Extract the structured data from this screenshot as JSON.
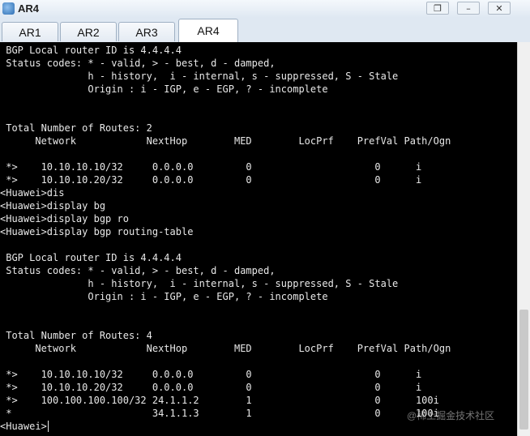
{
  "window": {
    "title": "AR4",
    "app_icon": "router-icon",
    "controls": {
      "restore": "❐",
      "minimize": "–",
      "close": "✕"
    }
  },
  "tabs": [
    {
      "label": "AR1",
      "active": false
    },
    {
      "label": "AR2",
      "active": false
    },
    {
      "label": "AR3",
      "active": false
    },
    {
      "label": "AR4",
      "active": true
    }
  ],
  "terminal": {
    "lines": [
      " BGP Local router ID is 4.4.4.4",
      " Status codes: * - valid, > - best, d - damped,",
      "               h - history,  i - internal, s - suppressed, S - Stale",
      "               Origin : i - IGP, e - EGP, ? - incomplete",
      "",
      "",
      " Total Number of Routes: 2",
      "      Network            NextHop        MED        LocPrf    PrefVal Path/Ogn",
      "",
      " *>    10.10.10.10/32     0.0.0.0         0                     0      i",
      " *>    10.10.10.20/32     0.0.0.0         0                     0      i",
      "<Huawei>dis",
      "<Huawei>display bg",
      "<Huawei>display bgp ro",
      "<Huawei>display bgp routing-table",
      "",
      " BGP Local router ID is 4.4.4.4",
      " Status codes: * - valid, > - best, d - damped,",
      "               h - history,  i - internal, s - suppressed, S - Stale",
      "               Origin : i - IGP, e - EGP, ? - incomplete",
      "",
      "",
      " Total Number of Routes: 4",
      "      Network            NextHop        MED        LocPrf    PrefVal Path/Ogn",
      "",
      " *>    10.10.10.10/32     0.0.0.0         0                     0      i",
      " *>    10.10.10.20/32     0.0.0.0         0                     0      i",
      " *>    100.100.100.100/32 24.1.1.2        1                     0      100i",
      " *                        34.1.1.3        1                     0      100i",
      "<Huawei>"
    ]
  },
  "watermark": "@稀土掘金技术社区"
}
